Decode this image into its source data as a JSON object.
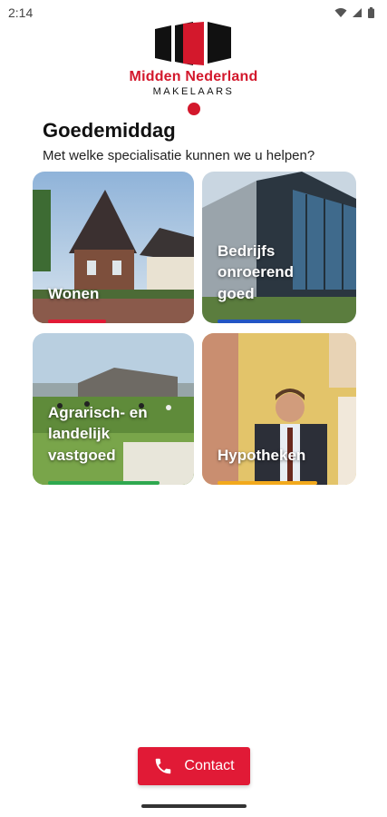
{
  "status_bar": {
    "time": "2:14"
  },
  "logo": {
    "name": "Midden Nederland",
    "sub": "MAKELAARS"
  },
  "greeting": {
    "title": "Goedemiddag",
    "subtitle": "Met welke specialisatie kunnen we u helpen?"
  },
  "tiles": [
    {
      "label": "Wonen",
      "accent": "#e11a36"
    },
    {
      "label": "Bedrijfs\nonroerend\ngoed",
      "accent": "#2255c4"
    },
    {
      "label": "Agrarisch- en\nlandelijk\nvastgoed",
      "accent": "#2fa84f"
    },
    {
      "label": "Hypotheken",
      "accent": "#f2a91c"
    }
  ],
  "contact": {
    "label": "Contact",
    "icon": "phone-icon"
  },
  "colors": {
    "brand_red": "#d3182c",
    "button_red": "#e11a36"
  }
}
